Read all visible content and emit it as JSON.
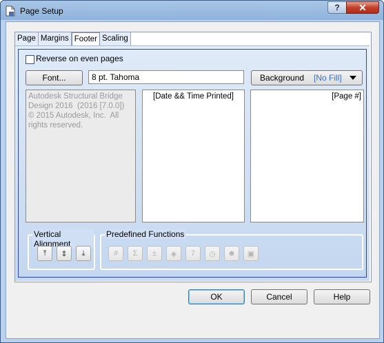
{
  "window": {
    "title": "Page Setup",
    "help_glyph": "?",
    "close_glyph": "✕"
  },
  "tabs": [
    {
      "label": "Page",
      "active": false
    },
    {
      "label": "Margins",
      "active": false
    },
    {
      "label": "Footer",
      "active": true
    },
    {
      "label": "Scaling",
      "active": false
    }
  ],
  "footer": {
    "reverse_label": "Reverse on even pages",
    "reverse_checked": false,
    "font_button": "Font...",
    "font_value": "8 pt. Tahoma",
    "background_label": "Background",
    "background_value": "[No Fill]",
    "left_text": "Autodesk Structural Bridge Design 2016  (2016 [7.0.0])\n© 2015 Autodesk, Inc.  All rights reserved.",
    "center_text": "[Date && Time Printed]",
    "right_text": "[Page #]"
  },
  "vertical_alignment": {
    "label": "Vertical Alignment",
    "buttons": [
      {
        "icon": "align-top-icon",
        "glyph": "⤒"
      },
      {
        "icon": "align-middle-icon",
        "glyph": "⇕"
      },
      {
        "icon": "align-bottom-icon",
        "glyph": "⤓"
      }
    ]
  },
  "predefined_functions": {
    "label": "Predefined Functions",
    "buttons": [
      {
        "icon": "page-number-icon",
        "glyph": "#"
      },
      {
        "icon": "sum-icon",
        "glyph": "Σ"
      },
      {
        "icon": "page-count-icon",
        "glyph": "±"
      },
      {
        "icon": "date-icon",
        "glyph": "◈"
      },
      {
        "icon": "calendar-icon",
        "glyph": "7"
      },
      {
        "icon": "clock-icon",
        "glyph": "◷"
      },
      {
        "icon": "user-icon",
        "glyph": "☻"
      },
      {
        "icon": "computer-icon",
        "glyph": "▣"
      }
    ]
  },
  "dialog_buttons": {
    "ok": "OK",
    "cancel": "Cancel",
    "help": "Help"
  }
}
